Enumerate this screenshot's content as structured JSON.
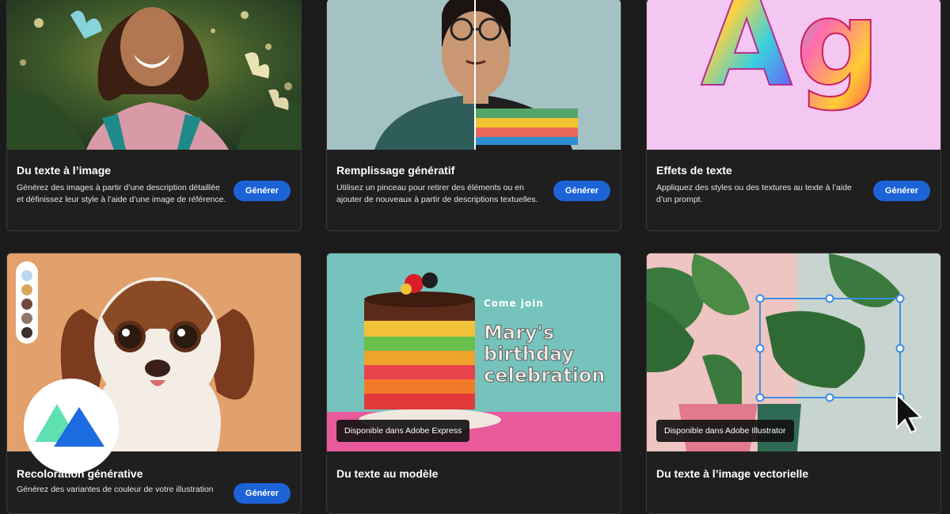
{
  "cards": [
    {
      "title": "Du texte à l’image",
      "description": "Générez des images à partir d’une description détaillée et définissez leur style à l’aide d’une image de référence.",
      "button": "Générer"
    },
    {
      "title": "Remplissage génératif",
      "description": "Utilisez un pinceau pour retirer des éléments ou en ajouter de nouveaux à partir de descriptions textuelles.",
      "button": "Générer"
    },
    {
      "title": "Effets de texte",
      "description": "Appliquez des styles ou des textures au texte à l’aide d’un prompt.",
      "button": "Générer",
      "art_text": "Ag"
    },
    {
      "title": "Recoloration générative",
      "description": "Générez des variantes de couleur de votre illustration",
      "button": "Générer",
      "swatches": [
        "#bcd7ec",
        "#d9a65c",
        "#6e4a3a",
        "#8e7767",
        "#3b3130"
      ]
    },
    {
      "title": "Du texte au modèle",
      "badge": "Disponible dans Adobe Express",
      "art_text": {
        "line1": "Come join",
        "line2": "Mary's",
        "line3": "birthday",
        "line4": "celebration"
      }
    },
    {
      "title": "Du texte à l’image vectorielle",
      "badge": "Disponible dans Adobe Illustrator"
    }
  ],
  "colors": {
    "accent": "#1d63d8",
    "background": "#1b1b1b",
    "card": "#1f1f1f"
  },
  "logo": {
    "icon": "brand-mountain-icon"
  }
}
